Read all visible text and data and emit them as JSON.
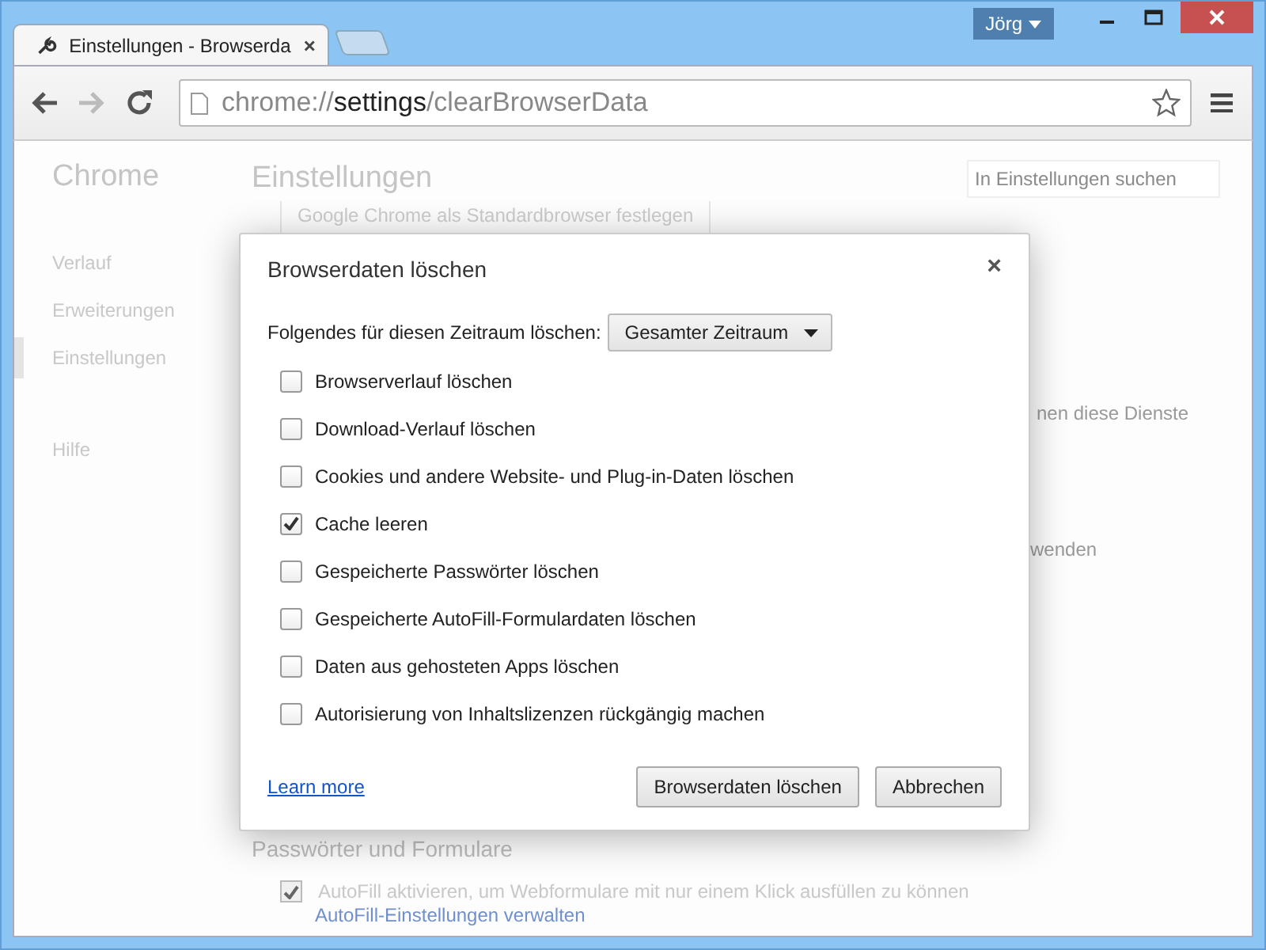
{
  "window": {
    "profile": "Jörg",
    "tabs": [
      {
        "title": "Einstellungen - Browserda",
        "selected": true
      }
    ]
  },
  "toolbar": {
    "address": {
      "scheme": "chrome://",
      "host": "settings",
      "path": "/clearBrowserData"
    }
  },
  "sidebar": {
    "title": "Chrome",
    "items": [
      {
        "label": "Verlauf",
        "selected": false
      },
      {
        "label": "Erweiterungen",
        "selected": false
      },
      {
        "label": "Einstellungen",
        "selected": true
      },
      {
        "label": "Hilfe",
        "selected": false
      }
    ]
  },
  "settings": {
    "title": "Einstellungen",
    "search": {
      "placeholder": "In Einstellungen suchen"
    },
    "default_browser_button": "Google Chrome als Standardbrowser festlegen",
    "partial_text_1": "nen diese Dienste",
    "partial_text_2": "wenden",
    "section_title": "Passwörter und Formulare",
    "autofill": {
      "label": "AutoFill aktivieren, um Webformulare mit nur einem Klick ausfüllen zu können",
      "checked": true
    },
    "autofill_link": "AutoFill-Einstellungen verwalten"
  },
  "dialog": {
    "title": "Browserdaten löschen",
    "close": "×",
    "range_label": "Folgendes für diesen Zeitraum löschen:",
    "range_value": "Gesamter Zeitraum",
    "options": [
      {
        "label": "Browserverlauf löschen",
        "checked": false
      },
      {
        "label": "Download-Verlauf löschen",
        "checked": false
      },
      {
        "label": "Cookies und andere Website- und Plug-in-Daten löschen",
        "checked": false
      },
      {
        "label": "Cache leeren",
        "checked": true
      },
      {
        "label": "Gespeicherte Passwörter löschen",
        "checked": false
      },
      {
        "label": "Gespeicherte AutoFill-Formulardaten löschen",
        "checked": false
      },
      {
        "label": "Daten aus gehosteten Apps löschen",
        "checked": false
      },
      {
        "label": "Autorisierung von Inhaltslizenzen rückgängig machen",
        "checked": false
      }
    ],
    "link": "Learn more",
    "buttons": [
      "Browserdaten löschen",
      "Abbrechen"
    ]
  }
}
